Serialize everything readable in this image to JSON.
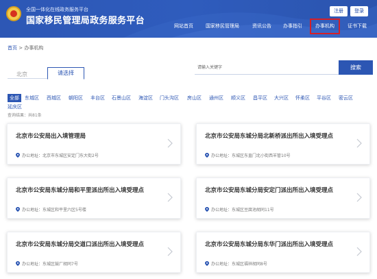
{
  "header": {
    "subtitle": "全国一体化在线政务服务平台",
    "title": "国家移民管理局政务服务平台",
    "register_label": "注册",
    "login_label": "登录",
    "nav": [
      "网站首页",
      "国家移民管理局",
      "资讯公告",
      "办事指引",
      "办事机构",
      "证书下载"
    ],
    "active_nav": "办事机构",
    "colors": {
      "primary": "#2c56b3",
      "highlight": "#d61f26"
    }
  },
  "breadcrumb": {
    "home": "首页",
    "separator": " > ",
    "current": "办事机构"
  },
  "tabs": {
    "city": "北京",
    "select": "请选择"
  },
  "search": {
    "placeholder": "请输入关键字",
    "button": "搜索"
  },
  "districts": [
    "全部",
    "东城区",
    "西城区",
    "朝阳区",
    "丰台区",
    "石景山区",
    "海淀区",
    "门头沟区",
    "房山区",
    "通州区",
    "顺义区",
    "昌平区",
    "大兴区",
    "怀柔区",
    "平谷区",
    "密云区",
    "延庆区"
  ],
  "selected_district": "全部",
  "result_count": "查询结果：共81条",
  "address_prefix": "办公地址：",
  "cards": [
    {
      "title": "北京市公安局出入境管理局",
      "address": "北京市东城区安定门东大街2号"
    },
    {
      "title": "北京市公安局东城分局北新桥派出所出入境受理点",
      "address": "东城区东直门北小街西羊管10号"
    },
    {
      "title": "北京市公安局东城分局和平里派出所出入境受理点",
      "address": "东城区和平里六区5号楼"
    },
    {
      "title": "北京市公安局东城分局安定门派出所出入境受理点",
      "address": "东城区豆腐池胡同11号"
    },
    {
      "title": "北京市公安局东城分局交道口派出所出入境受理点",
      "address": "东城区鼓厂胡同7号"
    },
    {
      "title": "北京市公安局东城分局东华门派出所出入境受理点",
      "address": "东城区福祥胡同8号"
    }
  ]
}
